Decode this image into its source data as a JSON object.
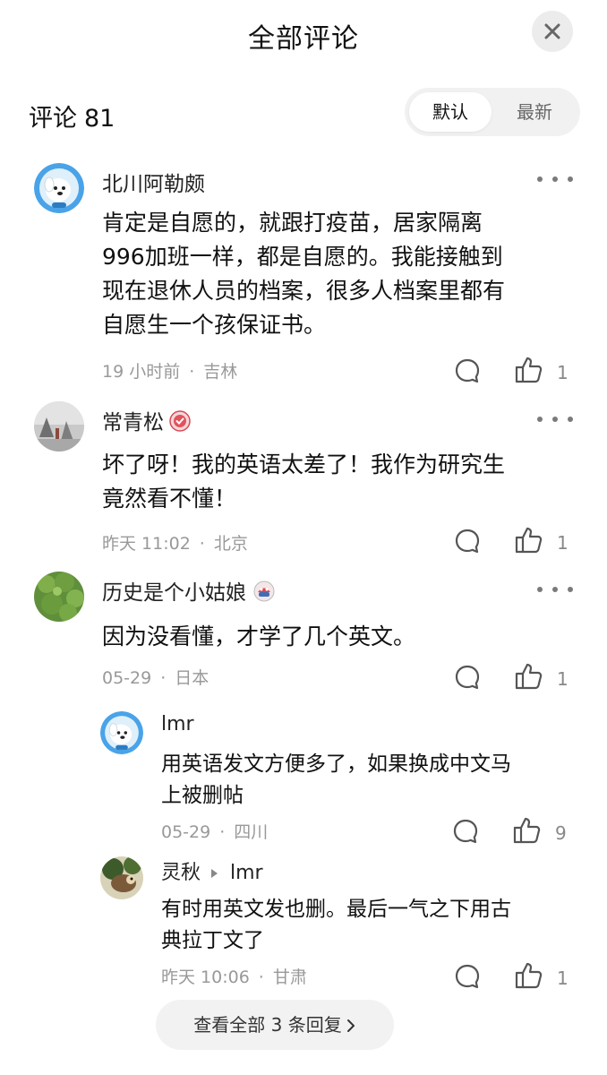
{
  "header": {
    "title": "全部评论",
    "close_icon": "close-icon"
  },
  "count": {
    "label": "评论",
    "value": "81"
  },
  "sort": {
    "default_label": "默认",
    "latest_label": "最新"
  },
  "comments": [
    {
      "username": "北川阿勒颇",
      "text_lines": [
        "肯定是自愿的，就跟打疫苗，居家隔离",
        "996加班一样，都是自愿的。我能接触到",
        "现在退休人员的档案，很多人档案里都有",
        "自愿生一个孩保证书。"
      ],
      "time": "19 小时前",
      "location": "吉林",
      "likes": "1"
    },
    {
      "username": "常青松",
      "badge": "verified-badge-icon",
      "text_lines": [
        "坏了呀！我的英语太差了！我作为研究生",
        "竟然看不懂！"
      ],
      "time": "昨天 11:02",
      "location": "北京",
      "likes": "1"
    },
    {
      "username": "历史是个小姑娘",
      "badge": "member-badge-icon",
      "text_lines": [
        "因为没看懂，才学了几个英文。"
      ],
      "time": "05-29",
      "location": "日本",
      "likes": "1"
    }
  ],
  "replies": [
    {
      "username": "lmr",
      "text_lines": [
        "用英语发文方便多了，如果换成中文马",
        "上被删帖"
      ],
      "time": "05-29",
      "location": "四川",
      "likes": "9"
    },
    {
      "username": "灵秋",
      "reply_to": "lmr",
      "text_lines": [
        "有时用英文发也删。最后一气之下用古",
        "典拉丁文了"
      ],
      "time": "昨天 10:06",
      "location": "甘肃",
      "likes": "1"
    }
  ],
  "view_all": {
    "label": "查看全部 3 条回复"
  },
  "meta_separator": "·",
  "colors": {
    "meta_text": "#999999",
    "icon_gray": "#7a7a7a",
    "toggle_bg": "#f1f1f1"
  }
}
